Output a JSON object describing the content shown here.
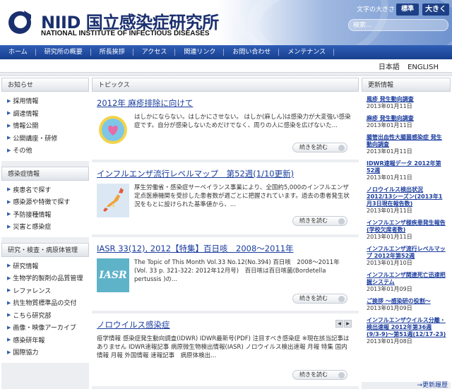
{
  "header": {
    "logo_jp": "NIID 国立感染症研究所",
    "logo_en": "NATIONAL INSTITUTE OF INFECTIOUS DISEASES",
    "font_size_label": "文字の大きさ",
    "font_std": "標準",
    "font_big": "大きく",
    "search_placeholder": "検索..."
  },
  "nav": [
    "ホーム",
    "研究所の概要",
    "所長挨拶",
    "アクセス",
    "関連リンク",
    "お問い合わせ",
    "メンテナンス"
  ],
  "lang": {
    "ja": "日本語",
    "en": "ENGLISH"
  },
  "left": {
    "notice": {
      "title": "お知らせ",
      "items": [
        "採用情報",
        "調達情報",
        "情報公開",
        "公開講座・研修",
        "その他"
      ]
    },
    "disease": {
      "title": "感染症情報",
      "items": [
        "疾患名で探す",
        "感染源や特徴で探す",
        "予防接種情報",
        "災害と感染症"
      ]
    },
    "research": {
      "title": "研究・検査・病原体管理",
      "items": [
        "研究情報",
        "生物学的製剤の品質管理",
        "レファレンス",
        "抗生物質標準品の交付",
        "こちら研究部",
        "画像・映像アーカイブ",
        "感染研年報",
        "国際協力"
      ]
    }
  },
  "center": {
    "title": "トピックス",
    "read_more": "続きを読む",
    "articles": [
      {
        "title": "2012年 麻疹排除に向けて",
        "text": "はしかにならない。はしかにさせない。 はしか(麻しん)は感染力が大変強い感染症です。自分が感染しないためだけでなく、周りの人に感染を広げないた..."
      },
      {
        "title": "インフルエンザ流行レベルマップ　第52週(1/10更新)",
        "text": "厚生労働省・感染症サーベイランス事業により、全国約5,000のインフルエンザ定点医療機関を受診した患者数が週ごとに把握されています。過去の患者発生状況をもとに設けられた基準値から、..."
      },
      {
        "title": "IASR 33(12), 2012【特集】百日咳　2008～2011年",
        "text": "The Topic of This Month Vol.33 No.12(No.394) 百日咳　2008～2011年 (Vol. 33 p. 321-322: 2012年12月号)　百日咳は百日咳菌(Bordetella pertussis )の...",
        "thumb_text": "IASR"
      },
      {
        "title": "ノロウイルス感染症",
        "text": "疫学情報 感染症発生動向調査(IDWR) IDWR最新号(PDF) 注目すべき感染症 ※現在該当記事はありません IDWR速報記事 病原微生物検出情報(IASR) ノロウイルス検出速報 月報 特集 国内情報 月報 外国情報 速報記事　病原体検出..."
      }
    ]
  },
  "right": {
    "title": "更新情報",
    "news": [
      {
        "title": "風疹 発生動向調査",
        "date": "2013年01月11日"
      },
      {
        "title": "麻疹 発生動向調査",
        "date": "2013年01月11日"
      },
      {
        "title": "腸管出血性大腸菌感染症 発生動向調査",
        "date": "2013年01月11日"
      },
      {
        "title": "IDWR速報データ 2012年第52週",
        "date": "2013年01月11日"
      },
      {
        "title": "ノロウイルス検出状況 2012/13シーズン(2013年1月3日現在報告数)",
        "date": "2013年01月11日"
      },
      {
        "title": "インフルエンザ様疾患発生報告(学校欠席者数)",
        "date": "2013年01月11日"
      },
      {
        "title": "インフルエンザ流行レベルマップ 2012年第52週",
        "date": "2013年01月10日"
      },
      {
        "title": "インフルエンザ関連死亡迅速把握システム",
        "date": "2013年01月09日"
      },
      {
        "title": "ご挨拶 ～感染研の役割～",
        "date": "2013年01月09日"
      },
      {
        "title": "インフルエンザウイルス分離・検出速報 2012年第36週(9/3-9)～第51週(12/17-23)",
        "date": "2013年01月08日"
      }
    ],
    "history": "→更新履歴"
  },
  "colors": {
    "nav": "#1f4ea3",
    "link": "#1a3c9e",
    "brand": "#1a2f6e"
  }
}
